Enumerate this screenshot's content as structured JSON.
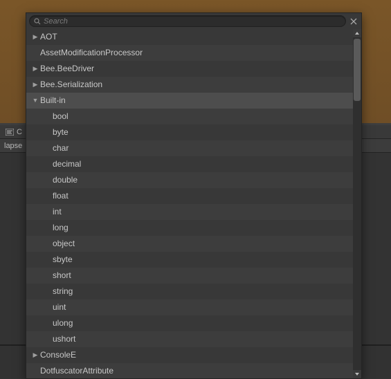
{
  "background": {
    "tab_label": "C",
    "toolbar_button": "lapse"
  },
  "search": {
    "placeholder": "Search",
    "value": ""
  },
  "tree": {
    "items": [
      {
        "label": "AOT",
        "depth": 0,
        "expander": "right",
        "selected": false
      },
      {
        "label": "AssetModificationProcessor",
        "depth": 0,
        "expander": "none",
        "selected": false
      },
      {
        "label": "Bee.BeeDriver",
        "depth": 0,
        "expander": "right",
        "selected": false
      },
      {
        "label": "Bee.Serialization",
        "depth": 0,
        "expander": "right",
        "selected": false
      },
      {
        "label": "Built-in",
        "depth": 0,
        "expander": "down",
        "selected": true
      },
      {
        "label": "bool",
        "depth": 1,
        "expander": "none",
        "selected": false
      },
      {
        "label": "byte",
        "depth": 1,
        "expander": "none",
        "selected": false
      },
      {
        "label": "char",
        "depth": 1,
        "expander": "none",
        "selected": false
      },
      {
        "label": "decimal",
        "depth": 1,
        "expander": "none",
        "selected": false
      },
      {
        "label": "double",
        "depth": 1,
        "expander": "none",
        "selected": false
      },
      {
        "label": "float",
        "depth": 1,
        "expander": "none",
        "selected": false
      },
      {
        "label": "int",
        "depth": 1,
        "expander": "none",
        "selected": false
      },
      {
        "label": "long",
        "depth": 1,
        "expander": "none",
        "selected": false
      },
      {
        "label": "object",
        "depth": 1,
        "expander": "none",
        "selected": false
      },
      {
        "label": "sbyte",
        "depth": 1,
        "expander": "none",
        "selected": false
      },
      {
        "label": "short",
        "depth": 1,
        "expander": "none",
        "selected": false
      },
      {
        "label": "string",
        "depth": 1,
        "expander": "none",
        "selected": false
      },
      {
        "label": "uint",
        "depth": 1,
        "expander": "none",
        "selected": false
      },
      {
        "label": "ulong",
        "depth": 1,
        "expander": "none",
        "selected": false
      },
      {
        "label": "ushort",
        "depth": 1,
        "expander": "none",
        "selected": false
      },
      {
        "label": "ConsoleE",
        "depth": 0,
        "expander": "right",
        "selected": false
      },
      {
        "label": "DotfuscatorAttribute",
        "depth": 0,
        "expander": "none",
        "selected": false
      }
    ]
  }
}
